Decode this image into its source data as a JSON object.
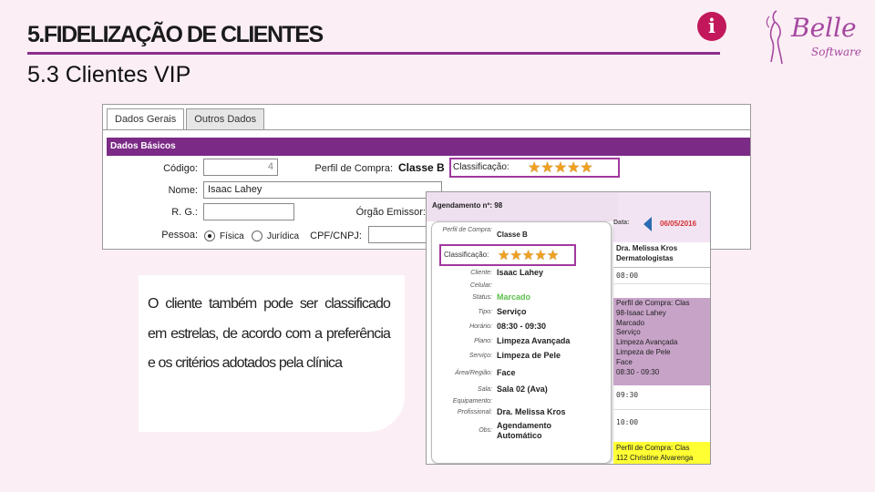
{
  "header": {
    "title": "5.FIDELIZAÇÃO DE CLIENTES",
    "subtitle": "5.3 Clientes VIP",
    "info_icon": "info-icon",
    "logo_word": "Belle",
    "logo_sub": "Software"
  },
  "form": {
    "tabs": [
      "Dados Gerais",
      "Outros Dados"
    ],
    "section": "Dados Básicos",
    "codigo_label": "Código:",
    "codigo_value": "4",
    "nome_label": "Nome:",
    "nome_value": "Isaac Lahey",
    "rg_label": "R. G.:",
    "pessoa_label": "Pessoa:",
    "pessoa_options": [
      "Física",
      "Jurídica"
    ],
    "perfil_label": "Perfil de Compra:",
    "perfil_value": "Classe B",
    "classificacao_label": "Classificação:",
    "rating": 5,
    "orgao_label": "Órgão Emissor:",
    "cpf_label": "CPF/CNPJ:"
  },
  "text_box": {
    "text": "O cliente também pode ser classificado em estrelas, de acordo com a preferência e os critérios adotados pela clínica"
  },
  "agenda": {
    "title": "Agendamento nº: 98",
    "perfil_label": "Perfil de Compra:",
    "perfil_value": "Classe B",
    "classificacao_label": "Classificação:",
    "rating": 5,
    "cliente_label": "Cliente:",
    "cliente_value": "Isaac Lahey",
    "celular_label": "Celular:",
    "status_label": "Status:",
    "status_value": "Marcado",
    "tipo_label": "Tipo:",
    "tipo_value": "Serviço",
    "horario_label": "Horário:",
    "horario_value": "08:30 - 09:30",
    "plano_label": "Plano:",
    "plano_value": "Limpeza Avançada",
    "servico_label": "Serviço:",
    "servico_value": "Limpeza de Pele",
    "area_label": "Área/Região:",
    "area_value": "Face",
    "sala_label": "Sala:",
    "sala_value": "Sala 02 (Ava)",
    "equip_label": "Equipamento:",
    "prof_label": "Profissional:",
    "prof_value": "Dra. Melissa Kros",
    "obs_label": "Obs:",
    "obs_value_1": "Agendamento",
    "obs_value_2": "Automático",
    "date_label": "Data:",
    "date_value": "06/05/2016",
    "doctor_line1": "Dra. Melissa Kros",
    "doctor_line2": "Dermatologistas",
    "slots": [
      "08:00",
      "09:30",
      "10:00"
    ],
    "appt1": [
      "Perfil de Compra: Clas",
      "98-Isaac Lahey",
      "Marcado",
      "Serviço",
      "Limpeza Avançada",
      "Limpeza de Pele",
      "Face",
      "08:30 - 09:30"
    ],
    "appt2": [
      "Perfil de Compra: Clas",
      "112 Christine Alvarenga"
    ]
  },
  "colors": {
    "brand": "#8a2e8c",
    "section_bar": "#7b2a86",
    "star": "#f0a020",
    "highlight_box": "#a1389f",
    "status_green": "#5bc04a",
    "appt_purple": "#c7a3c8",
    "appt_yellow": "#ffff33"
  }
}
